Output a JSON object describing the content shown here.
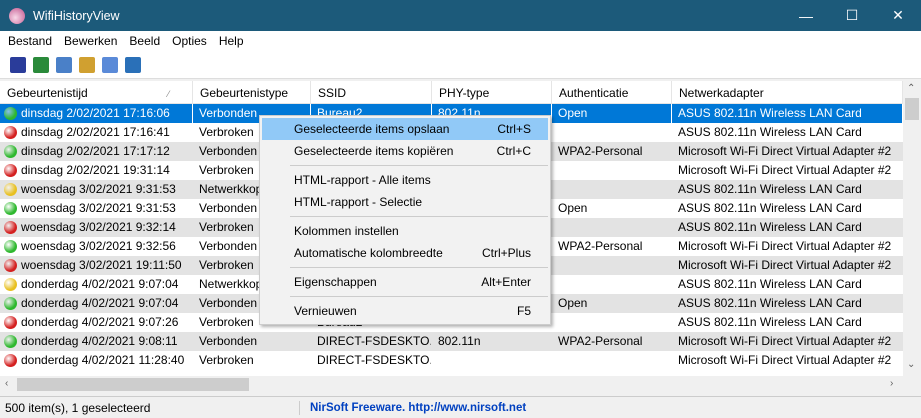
{
  "window": {
    "title": "WifiHistoryView",
    "minimize": "—",
    "maximize": "☐",
    "close": "✕"
  },
  "menubar": [
    "Bestand",
    "Bewerken",
    "Beeld",
    "Opties",
    "Help"
  ],
  "toolbar": [
    {
      "icon": "save-icon",
      "color": "#2a3c9a"
    },
    {
      "icon": "refresh-icon",
      "color": "#2a8a3a"
    },
    {
      "icon": "copy-icon",
      "color": "#4a80c8"
    },
    {
      "icon": "html-report-icon",
      "color": "#d0a030"
    },
    {
      "icon": "properties-icon",
      "color": "#5a8ad8"
    },
    {
      "icon": "exit-icon",
      "color": "#2a70b8"
    }
  ],
  "columns": [
    "Gebeurtenistijd",
    "Gebeurtenistype",
    "SSID",
    "PHY-type",
    "Authenticatie",
    "Netwerkadapter"
  ],
  "sort_indicator": "⁄",
  "rows": [
    {
      "status": "green",
      "cells": [
        "dinsdag 2/02/2021 17:16:06",
        "Verbonden",
        "Bureau2",
        "802.11n",
        "Open",
        "ASUS 802.11n Wireless LAN Card"
      ]
    },
    {
      "status": "red",
      "cells": [
        "dinsdag 2/02/2021 17:16:41",
        "Verbroken",
        "",
        "",
        "",
        "ASUS 802.11n Wireless LAN Card"
      ]
    },
    {
      "status": "green",
      "cells": [
        "dinsdag 2/02/2021 17:17:12",
        "Verbonden",
        "",
        "",
        "WPA2-Personal",
        "Microsoft Wi-Fi Direct Virtual Adapter #2"
      ]
    },
    {
      "status": "red",
      "cells": [
        "dinsdag 2/02/2021 19:31:14",
        "Verbroken",
        "",
        "",
        "",
        "Microsoft Wi-Fi Direct Virtual Adapter #2"
      ]
    },
    {
      "status": "yellow",
      "cells": [
        "woensdag 3/02/2021 9:31:53",
        "Netwerkkop",
        "",
        "",
        "",
        "ASUS 802.11n Wireless LAN Card"
      ]
    },
    {
      "status": "green",
      "cells": [
        "woensdag 3/02/2021 9:31:53",
        "Verbonden",
        "",
        "",
        "Open",
        "ASUS 802.11n Wireless LAN Card"
      ]
    },
    {
      "status": "red",
      "cells": [
        "woensdag 3/02/2021 9:32:14",
        "Verbroken",
        "",
        "",
        "",
        "ASUS 802.11n Wireless LAN Card"
      ]
    },
    {
      "status": "green",
      "cells": [
        "woensdag 3/02/2021 9:32:56",
        "Verbonden",
        "",
        "",
        "WPA2-Personal",
        "Microsoft Wi-Fi Direct Virtual Adapter #2"
      ]
    },
    {
      "status": "red",
      "cells": [
        "woensdag 3/02/2021 19:11:50",
        "Verbroken",
        "",
        "",
        "",
        "Microsoft Wi-Fi Direct Virtual Adapter #2"
      ]
    },
    {
      "status": "yellow",
      "cells": [
        "donderdag 4/02/2021 9:07:04",
        "Netwerkkop",
        "",
        "",
        "",
        "ASUS 802.11n Wireless LAN Card"
      ]
    },
    {
      "status": "green",
      "cells": [
        "donderdag 4/02/2021 9:07:04",
        "Verbonden",
        "",
        "",
        "Open",
        "ASUS 802.11n Wireless LAN Card"
      ]
    },
    {
      "status": "red",
      "cells": [
        "donderdag 4/02/2021 9:07:26",
        "Verbroken",
        "Bureau2",
        "",
        "",
        "ASUS 802.11n Wireless LAN Card"
      ]
    },
    {
      "status": "green",
      "cells": [
        "donderdag 4/02/2021 9:08:11",
        "Verbonden",
        "DIRECT-FSDESKTO...",
        "802.11n",
        "WPA2-Personal",
        "Microsoft Wi-Fi Direct Virtual Adapter #2"
      ]
    },
    {
      "status": "red",
      "cells": [
        "donderdag 4/02/2021 11:28:40",
        "Verbroken",
        "DIRECT-FSDESKTO...",
        "",
        "",
        "Microsoft Wi-Fi Direct Virtual Adapter #2"
      ]
    }
  ],
  "status_colors": {
    "green": "#2eb82e",
    "red": "#d42020",
    "yellow": "#e8c020"
  },
  "context_menu": [
    [
      {
        "label": "Geselecteerde items opslaan",
        "shortcut": "Ctrl+S"
      },
      {
        "label": "Geselecteerde items kopiëren",
        "shortcut": "Ctrl+C"
      }
    ],
    [
      {
        "label": "HTML-rapport - Alle items",
        "shortcut": ""
      },
      {
        "label": "HTML-rapport - Selectie",
        "shortcut": ""
      }
    ],
    [
      {
        "label": "Kolommen instellen",
        "shortcut": ""
      },
      {
        "label": "Automatische kolombreedte",
        "shortcut": "Ctrl+Plus"
      }
    ],
    [
      {
        "label": "Eigenschappen",
        "shortcut": "Alt+Enter"
      }
    ],
    [
      {
        "label": "Vernieuwen",
        "shortcut": "F5"
      }
    ]
  ],
  "statusbar": {
    "count": "500 item(s), 1 geselecteerd",
    "credit": "NirSoft Freeware.  http://www.nirsoft.net"
  }
}
